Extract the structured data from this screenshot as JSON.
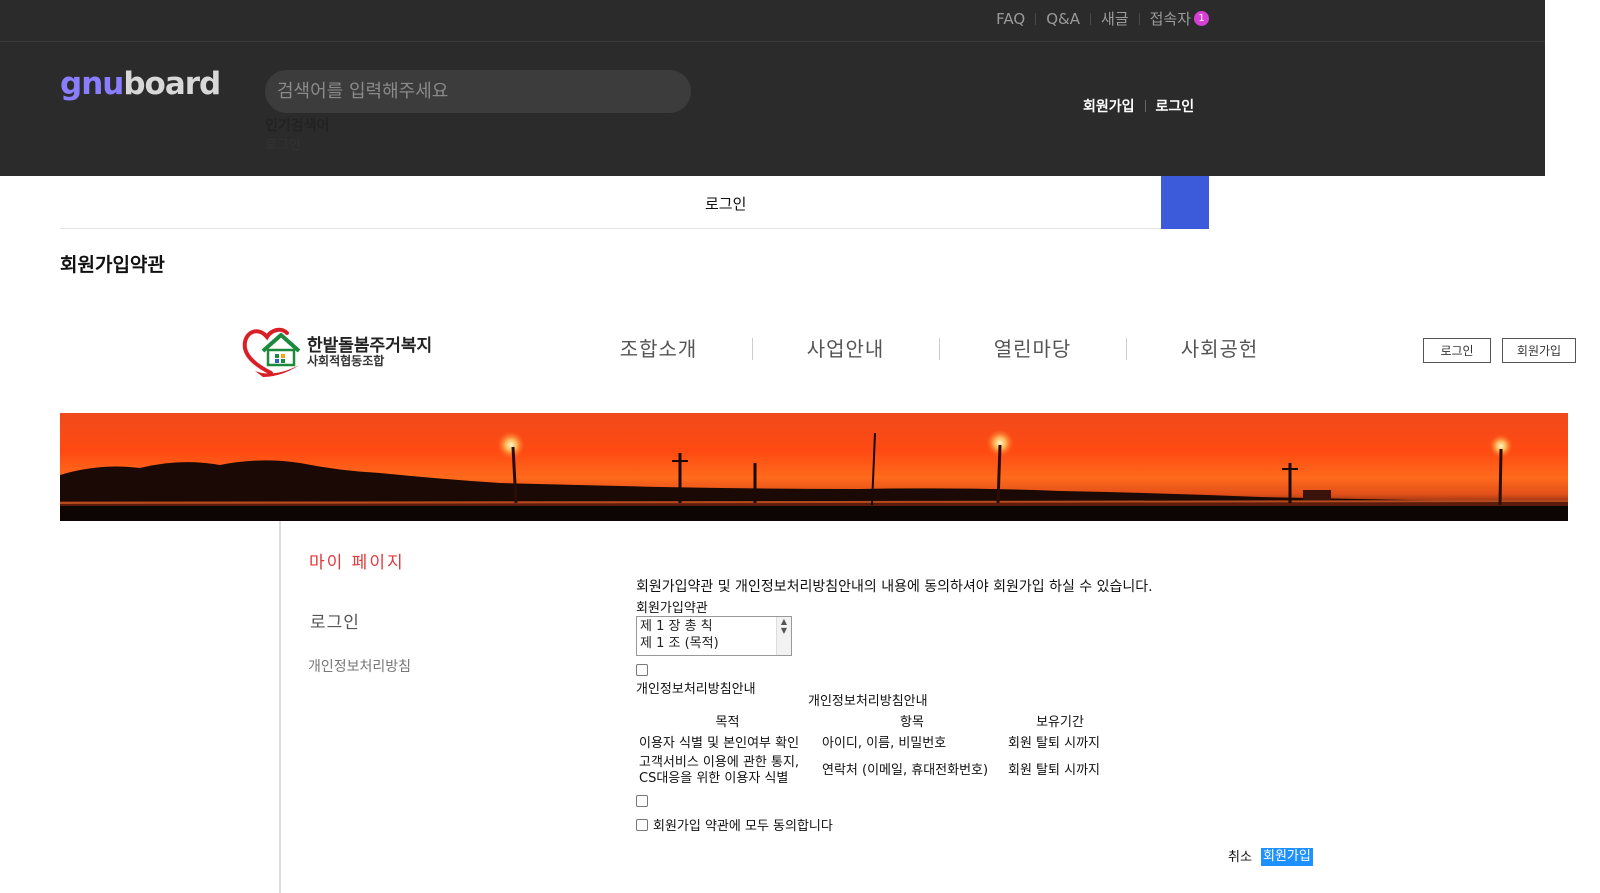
{
  "topbar": {
    "links": [
      "FAQ",
      "Q&A",
      "새글",
      "접속자"
    ],
    "visitor_count": "1"
  },
  "header": {
    "logo_part1": "gnu",
    "logo_part2": "board",
    "search_placeholder": "검색어를 입력해주세요",
    "popular_label": "인기검색어",
    "popular_item": "로그인",
    "join": "회원가입",
    "login": "로그인"
  },
  "gnb": {
    "title": "로그인"
  },
  "page": {
    "title": "회원가입약관"
  },
  "site": {
    "logo_line1": "한밭돌봄주거복지",
    "logo_line2": "사회적협동조합",
    "menu": [
      "조합소개",
      "사업안내",
      "열린마당",
      "사회공헌"
    ],
    "login_btn": "로그인",
    "join_btn": "회원가입"
  },
  "sidebar": {
    "mypage": "마이 페이지",
    "login": "로그인",
    "privacy": "개인정보처리방침"
  },
  "content": {
    "notice": "회원가입약관 및 개인정보처리방침안내의 내용에 동의하셔야 회원가입 하실 수 있습니다.",
    "terms_label": "회원가입약관",
    "terms_line1": "제 1 장 총 칙",
    "terms_line2": "제 1 조 (목적)",
    "privacy_label": "개인정보처리방침안내",
    "privacy_caption": "개인정보처리방침안내",
    "table": {
      "headers": [
        "목적",
        "항목",
        "보유기간"
      ],
      "rows": [
        [
          "이용자 식별 및 본인여부 확인",
          "아이디, 이름, 비밀번호",
          "회원 탈퇴 시까지"
        ],
        [
          "고객서비스 이용에 관한 통지,",
          "연락처 (이메일, 휴대전화번호)",
          "회원 탈퇴 시까지"
        ]
      ],
      "row2_line2": "CS대응을 위한 이용자 식별"
    },
    "agree_all": "회원가입 약관에 모두 동의합니다",
    "cancel": "취소",
    "submit": "회원가입"
  },
  "colors": {
    "header_bg": "#2b2b2b",
    "accent_blue": "#3b5bdb",
    "mypage_red": "#e0393e",
    "submit_blue": "#1e90ff"
  }
}
